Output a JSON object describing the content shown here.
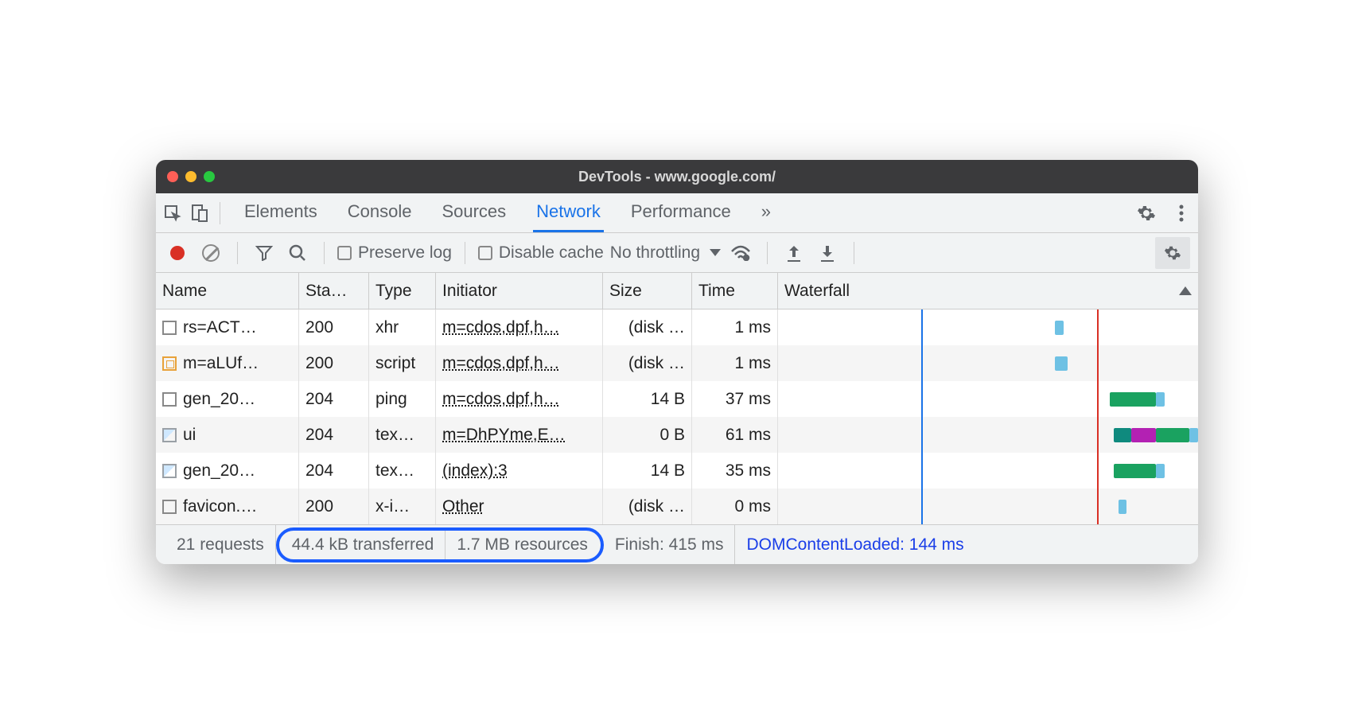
{
  "window": {
    "title": "DevTools - www.google.com/"
  },
  "tabs": {
    "items": [
      "Elements",
      "Console",
      "Sources",
      "Network",
      "Performance"
    ],
    "active": "Network"
  },
  "toolbar": {
    "preserve_log": "Preserve log",
    "disable_cache": "Disable cache",
    "throttling": "No throttling"
  },
  "columns": {
    "name": "Name",
    "status": "Sta…",
    "type": "Type",
    "initiator": "Initiator",
    "size": "Size",
    "time": "Time",
    "waterfall": "Waterfall"
  },
  "rows": [
    {
      "icon": "doc",
      "name": "rs=ACT…",
      "status": "200",
      "type": "xhr",
      "initiator": "m=cdos,dpf,h…",
      "size": "(disk …",
      "time": "1 ms",
      "bars": [
        {
          "l": 66,
          "w": 2,
          "c": "#6ec1e4"
        }
      ]
    },
    {
      "icon": "script",
      "name": "m=aLUf…",
      "status": "200",
      "type": "script",
      "initiator": "m=cdos,dpf,h…",
      "size": "(disk …",
      "time": "1 ms",
      "bars": [
        {
          "l": 66,
          "w": 3,
          "c": "#6ec1e4"
        }
      ]
    },
    {
      "icon": "doc",
      "name": "gen_20…",
      "status": "204",
      "type": "ping",
      "initiator": "m=cdos,dpf,h…",
      "size": "14 B",
      "time": "37 ms",
      "bars": [
        {
          "l": 79,
          "w": 11,
          "c": "#1aa260"
        },
        {
          "l": 90,
          "w": 2,
          "c": "#6ec1e4"
        }
      ]
    },
    {
      "icon": "img",
      "name": "ui",
      "status": "204",
      "type": "tex…",
      "initiator": "m=DhPYme,E…",
      "size": "0 B",
      "time": "61 ms",
      "bars": [
        {
          "l": 80,
          "w": 4,
          "c": "#0f8a7e"
        },
        {
          "l": 84,
          "w": 6,
          "c": "#b321b3"
        },
        {
          "l": 90,
          "w": 8,
          "c": "#1aa260"
        },
        {
          "l": 98,
          "w": 2,
          "c": "#6ec1e4"
        }
      ]
    },
    {
      "icon": "img",
      "name": "gen_20…",
      "status": "204",
      "type": "tex…",
      "initiator": "(index):3",
      "size": "14 B",
      "time": "35 ms",
      "bars": [
        {
          "l": 80,
          "w": 10,
          "c": "#1aa260"
        },
        {
          "l": 90,
          "w": 2,
          "c": "#6ec1e4"
        }
      ]
    },
    {
      "icon": "doc",
      "name": "favicon.…",
      "status": "200",
      "type": "x-i…",
      "initiator": "Other",
      "size": "(disk …",
      "time": "0 ms",
      "bars": [
        {
          "l": 81,
          "w": 2,
          "c": "#6ec1e4"
        }
      ]
    }
  ],
  "waterfall": {
    "blue_line_pct": 34,
    "red_line_pct": 76
  },
  "status": {
    "requests": "21 requests",
    "transferred": "44.4 kB transferred",
    "resources": "1.7 MB resources",
    "finish": "Finish: 415 ms",
    "dcl": "DOMContentLoaded: 144 ms"
  }
}
